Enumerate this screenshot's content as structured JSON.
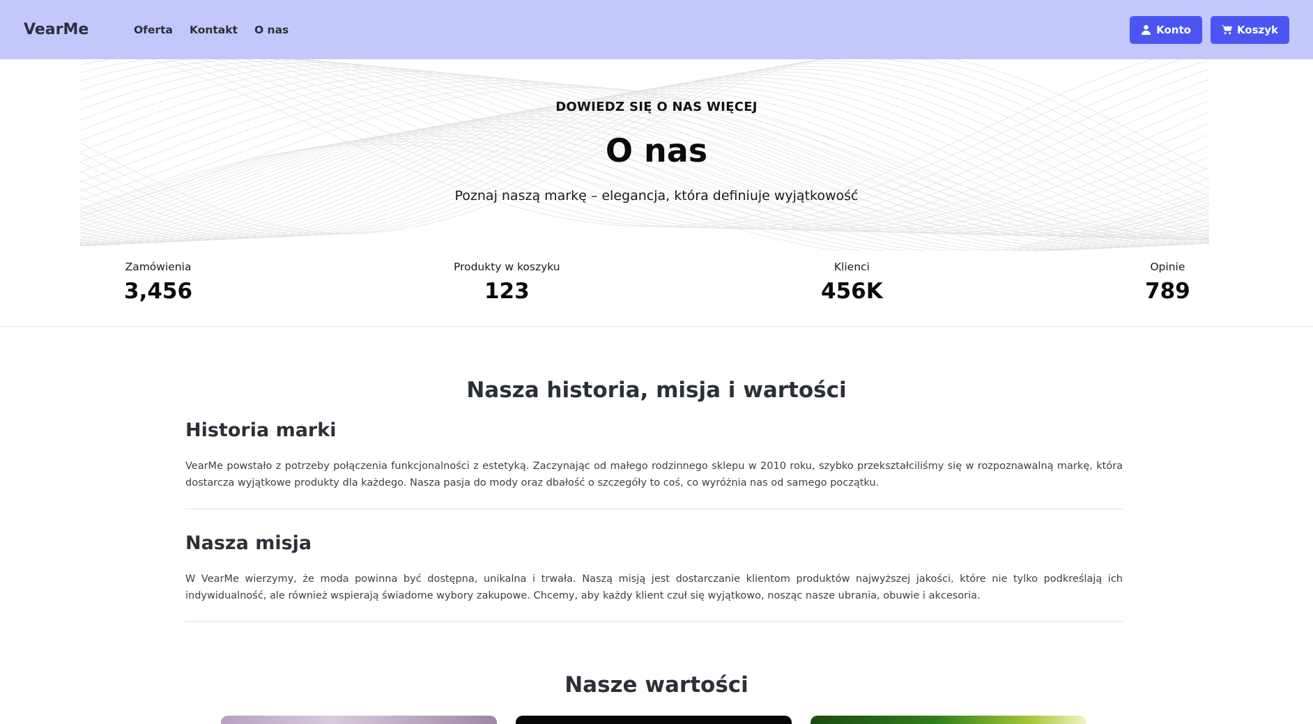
{
  "navbar": {
    "brand": "VearMe",
    "links": [
      {
        "label": "Oferta"
      },
      {
        "label": "Kontakt"
      },
      {
        "label": "O nas"
      }
    ],
    "account_label": "Konto",
    "cart_label": "Koszyk",
    "background": "#c3c7fb",
    "button_color": "#4b56f2"
  },
  "hero": {
    "eyebrow": "DOWIEDZ SIĘ O NAS WIĘCEJ",
    "title": "O nas",
    "subtitle": "Poznaj naszą markę – elegancja, która definiuje wyjątkowość"
  },
  "stats": [
    {
      "label": "Zamówienia",
      "value": "3,456"
    },
    {
      "label": "Produkty w koszyku",
      "value": "123"
    },
    {
      "label": "Klienci",
      "value": "456K"
    },
    {
      "label": "Opinie",
      "value": "789"
    }
  ],
  "about": {
    "section_title": "Nasza historia, misja i wartości",
    "history": {
      "title": "Historia marki",
      "text": "VearMe powstało z potrzeby połączenia funkcjonalności z estetyką. Zaczynając od małego rodzinnego sklepu w 2010 roku, szybko przekształciliśmy się w rozpoznawalną markę, która dostarcza wyjątkowe produkty dla każdego. Nasza pasja do mody oraz dbałość o szczegóły to coś, co wyróżnia nas od samego początku."
    },
    "mission": {
      "title": "Nasza misja",
      "text": "W VearMe wierzymy, że moda powinna być dostępna, unikalna i trwała. Naszą misją jest dostarczanie klientom produktów najwyższej jakości, które nie tylko podkreślają ich indywidualność, ale również wspierają świadome wybory zakupowe. Chcemy, aby każdy klient czuł się wyjątkowo, nosząc nasze ubrania, obuwie i akcesoria."
    }
  },
  "values": {
    "section_title": "Nasze wartości"
  }
}
